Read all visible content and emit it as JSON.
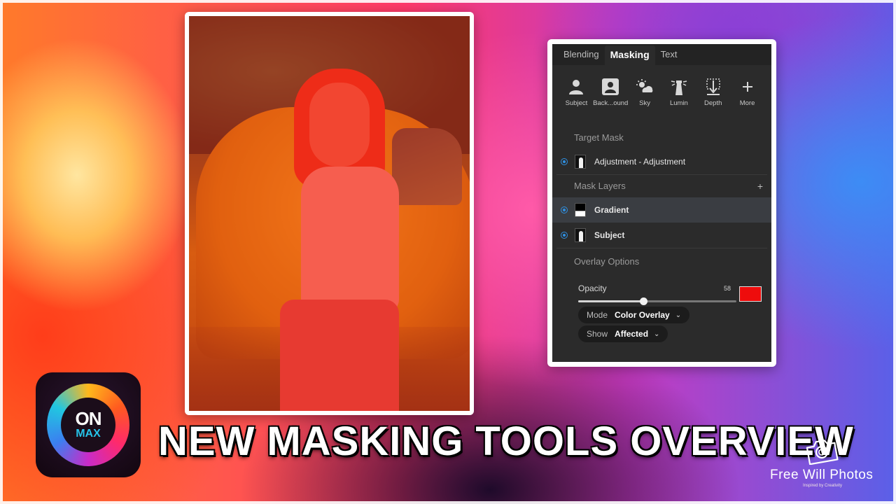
{
  "panel": {
    "tabs": [
      "Blending",
      "Masking",
      "Text"
    ],
    "active_tab": "Masking",
    "tools": [
      {
        "icon": "subject-icon",
        "label": "Subject"
      },
      {
        "icon": "background-icon",
        "label": "Back...ound"
      },
      {
        "icon": "sky-icon",
        "label": "Sky"
      },
      {
        "icon": "luminosity-icon",
        "label": "Lumin"
      },
      {
        "icon": "depth-icon",
        "label": "Depth"
      },
      {
        "icon": "plus-icon",
        "label": "More"
      }
    ],
    "target_mask": {
      "title": "Target Mask",
      "item": "Adjustment - Adjustment"
    },
    "mask_layers": {
      "title": "Mask Layers",
      "add_symbol": "+",
      "items": [
        "Gradient",
        "Subject"
      ]
    },
    "overlay_options": {
      "title": "Overlay Options",
      "opacity_label": "Opacity",
      "opacity_value": "58",
      "opacity_fraction": 0.41,
      "overlay_color": "#ee0c0c",
      "mode_label": "Mode",
      "mode_value": "Color Overlay",
      "show_label": "Show",
      "show_value": "Affected"
    }
  },
  "logo": {
    "line1": "ON",
    "line2": "MAX"
  },
  "headline": "NEW MASKING TOOLS OVERVIEW",
  "watermark": {
    "name": "Free Will Photos",
    "tagline": "Inspired by Creativity"
  }
}
